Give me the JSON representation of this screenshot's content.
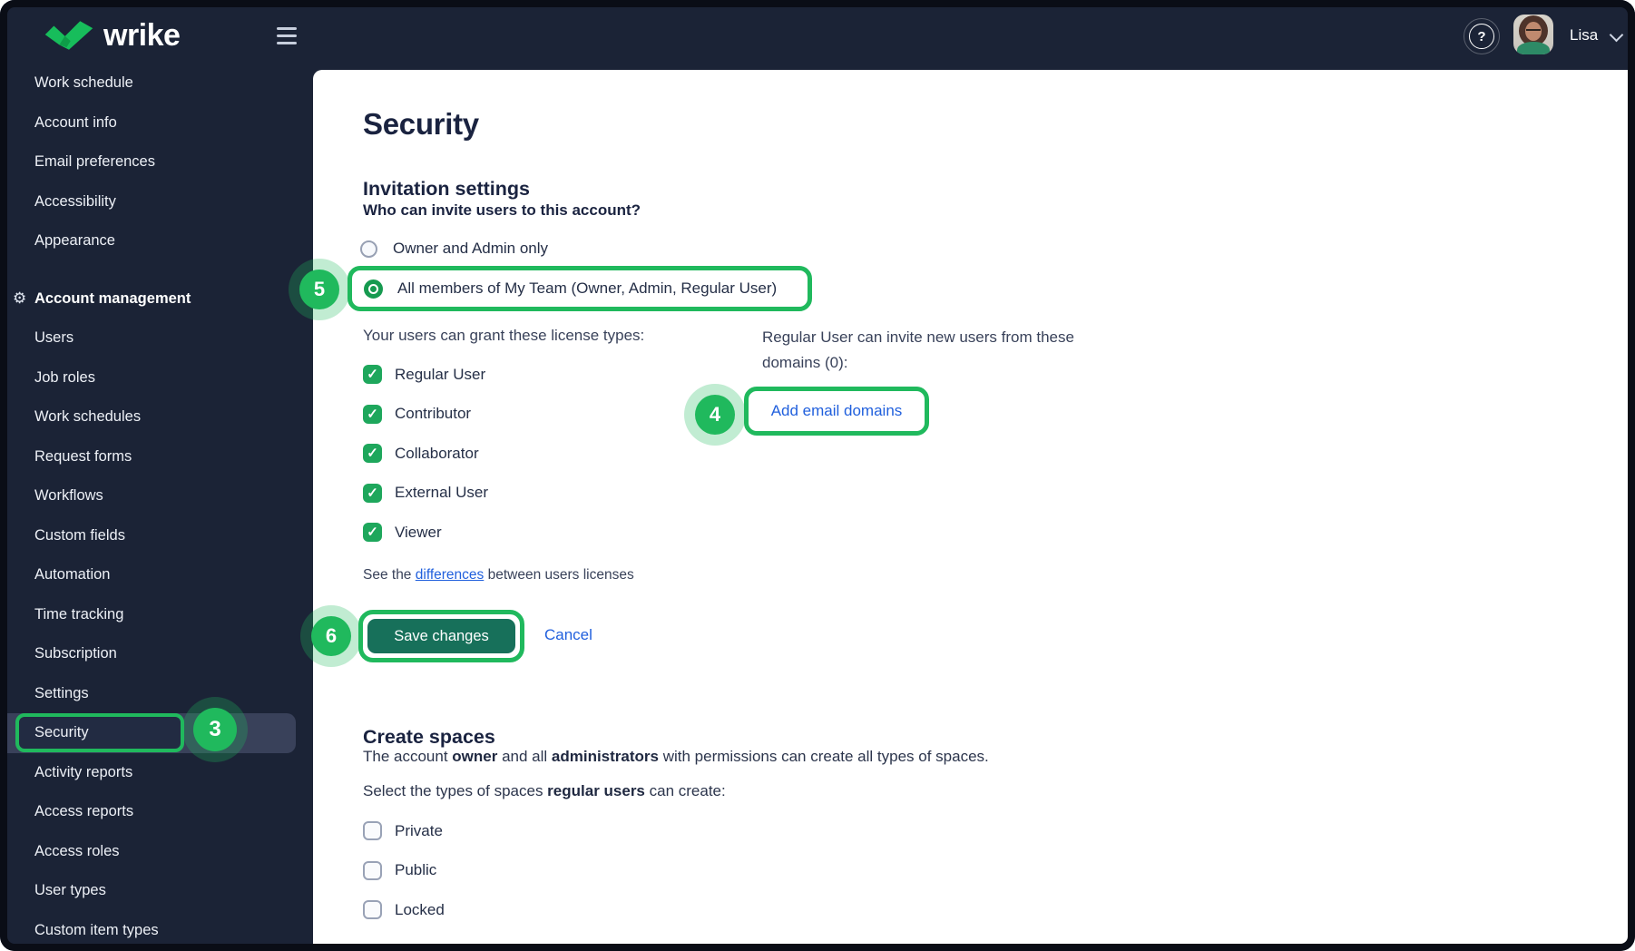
{
  "topbar": {
    "brand_wordmark": "wrike",
    "help_glyph": "?",
    "user_name": "Lisa"
  },
  "sidebar": {
    "general_items": [
      "Work schedule",
      "Account info",
      "Email preferences",
      "Accessibility",
      "Appearance"
    ],
    "management_header": "Account management",
    "management_items": [
      "Users",
      "Job roles",
      "Work schedules",
      "Request forms",
      "Workflows",
      "Custom fields",
      "Automation",
      "Time tracking",
      "Subscription",
      "Settings",
      "Security",
      "Activity reports",
      "Access reports",
      "Access roles",
      "User types",
      "Custom item types"
    ],
    "active_item": "Security"
  },
  "annotation_steps": {
    "security_nav": "3",
    "add_domains": "4",
    "members_radio": "5",
    "save": "6"
  },
  "main": {
    "title": "Security",
    "invitation_settings": {
      "heading": "Invitation settings",
      "question": "Who can invite users to this account?",
      "options": [
        {
          "label": "Owner and Admin only",
          "selected": false
        },
        {
          "label": "All members of My Team (Owner, Admin, Regular User)",
          "selected": true
        }
      ],
      "licenses_label": "Your users can grant these license types:",
      "license_types": [
        "Regular User",
        "Contributor",
        "Collaborator",
        "External User",
        "Viewer"
      ],
      "domains_label": "Regular User can invite new users from these domains (0):",
      "add_domains_link": "Add email domains",
      "note": {
        "prefix": "See the ",
        "link_text": "differences",
        "suffix": " between users licenses"
      },
      "save_button": "Save changes",
      "cancel_link": "Cancel"
    },
    "create_spaces": {
      "heading": "Create spaces",
      "description": {
        "p1": "The account ",
        "b1": "owner",
        "p2": " and all ",
        "b2": "administrators",
        "p3": " with permissions can create all types of spaces."
      },
      "select_line": {
        "p1": "Select the types of spaces ",
        "b1": "regular users",
        "p2": " can create:"
      },
      "space_types": [
        "Private",
        "Public",
        "Locked"
      ]
    }
  },
  "colors": {
    "navy_bg": "#1b2336",
    "sidebar_highlight": "#39415a",
    "annotation_green": "#20b95d",
    "checkbox_green": "#1ea75c",
    "radio_green": "#169a50",
    "save_button_green": "#17705a",
    "link_blue": "#2160dd",
    "heading_navy": "#1a2340"
  }
}
